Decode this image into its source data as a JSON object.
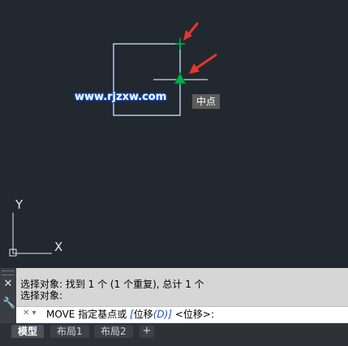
{
  "canvas": {
    "watermark": "www.rjzxw.com",
    "snap_tooltip": "中点",
    "ucs_x_label": "X",
    "ucs_y_label": "Y",
    "colors": {
      "background": "#212830",
      "selection": "#cfe2ff",
      "snap_marker": "#00b050",
      "arrow": "#e8362b"
    }
  },
  "command_panel": {
    "history": [
      "选择对象: 找到 1 个 (1 个重复), 总计 1 个",
      "选择对象:"
    ],
    "prompt": {
      "command": "MOVE 指定基点或",
      "option_open": "[",
      "option_text": "位移",
      "option_key": "(D)",
      "option_close": "]",
      "default": "<位移>:"
    }
  },
  "tabs": [
    "模型",
    "布局1",
    "布局2"
  ],
  "add_tab_label": "+"
}
